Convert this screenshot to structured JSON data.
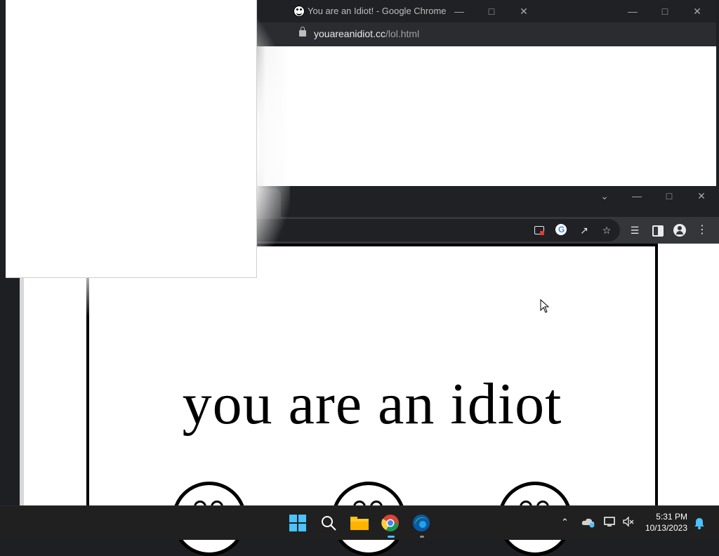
{
  "top_window": {
    "favicon": "smiley-icon",
    "title": "You are an Idiot! - Google Chrome",
    "url_domain": "youareanidiot.cc",
    "url_path": "/lol.html"
  },
  "main_window": {
    "headline": "you are an idiot"
  },
  "taskbar": {
    "time": "5:31 PM",
    "date": "10/13/2023"
  },
  "colors": {
    "chrome_dark": "#202124",
    "toolbar": "#35363a",
    "taskbar": "#202020",
    "page_bg": "#ffffff",
    "text": "#000000"
  }
}
